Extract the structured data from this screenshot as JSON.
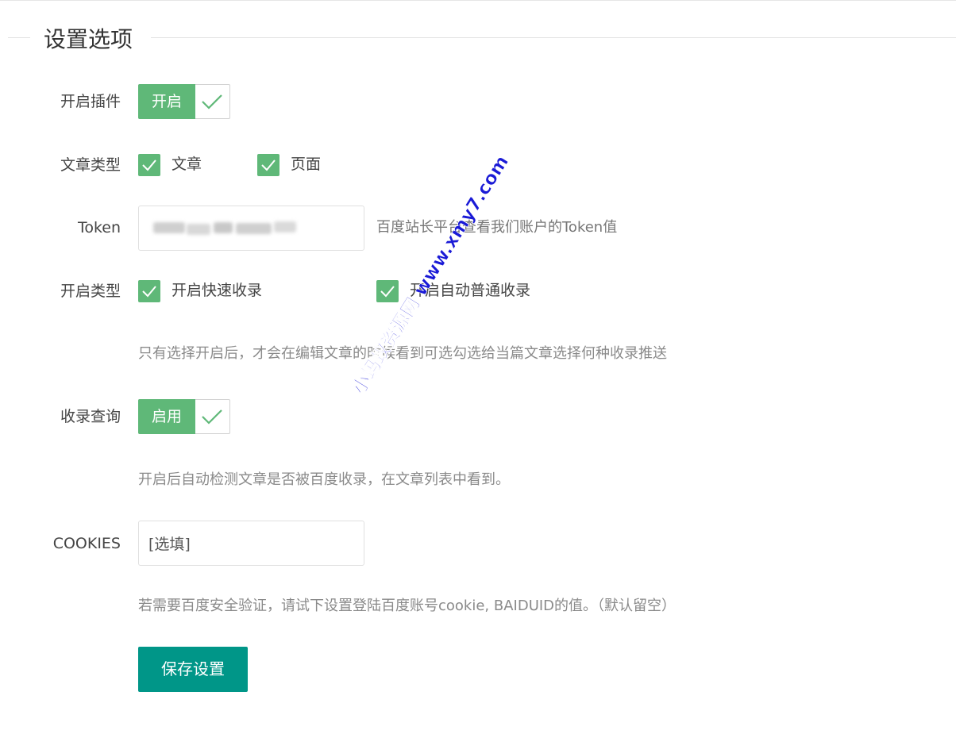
{
  "section": {
    "title": "设置选项"
  },
  "plugin": {
    "label": "开启插件",
    "switch_text": "开启",
    "on": true
  },
  "post_types": {
    "label": "文章类型",
    "options": [
      {
        "label": "文章",
        "checked": true
      },
      {
        "label": "页面",
        "checked": true
      }
    ]
  },
  "token": {
    "label": "Token",
    "hint": "百度站长平台查看我们账户的Token值"
  },
  "push_types": {
    "label": "开启类型",
    "options": [
      {
        "label": "开启快速收录",
        "checked": true
      },
      {
        "label": "开启自动普通收录",
        "checked": true
      }
    ],
    "hint": "只有选择开启后，才会在编辑文章的时候看到可选勾选给当篇文章选择何种收录推送"
  },
  "index_query": {
    "label": "收录查询",
    "switch_text": "启用",
    "on": true,
    "hint": "开启后自动检测文章是否被百度收录，在文章列表中看到。"
  },
  "cookies": {
    "label": "COOKIES",
    "value": "[选填]",
    "hint": "若需要百度安全验证，请试下设置登陆百度账号cookie, BAIDUID的值。（默认留空）"
  },
  "save_button": {
    "label": "保存设置"
  },
  "watermark": {
    "text": "小蚂蚁资源网 www.xmy7.com"
  },
  "colors": {
    "switch_on": "#5fb878",
    "checkbox": "#5fb878",
    "primary_button": "#009688"
  }
}
